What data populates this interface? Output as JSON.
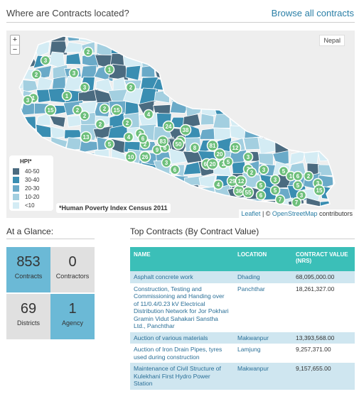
{
  "header": {
    "title": "Where are Contracts located?",
    "browse_link": "Browse all contracts"
  },
  "map": {
    "zoom_in": "+",
    "zoom_out": "−",
    "country_label": "Nepal",
    "legend": {
      "title": "HPI*",
      "items": [
        {
          "label": "40-50",
          "color": "#4b6b80"
        },
        {
          "label": "30-40",
          "color": "#3a8eb2"
        },
        {
          "label": "20-30",
          "color": "#6aaac8"
        },
        {
          "label": "10-20",
          "color": "#a3cfe0"
        },
        {
          "label": "<10",
          "color": "#d4ecf4"
        }
      ]
    },
    "footnote": "*Human Poverty Index Census 2011",
    "attribution": {
      "leaflet": "Leaflet",
      "sep": " | © ",
      "osm": "OpenStreetMap",
      "suffix": " contributors"
    },
    "markers": [
      "2",
      "3",
      "1",
      "2",
      "3",
      "1",
      "3",
      "1",
      "2",
      "3",
      "15",
      "2",
      "2",
      "2",
      "4",
      "2",
      "2",
      "15",
      "4",
      "2",
      "2",
      "13",
      "5",
      "6",
      "9",
      "24",
      "38",
      "6",
      "6",
      "83",
      "50",
      "8",
      "81",
      "12",
      "3",
      "2",
      "20",
      "5",
      "10",
      "26",
      "3",
      "6",
      "63",
      "20",
      "3",
      "3",
      "5",
      "1",
      "6",
      "3",
      "2",
      "3",
      "15",
      "5",
      "3",
      "5",
      "29",
      "5",
      "36",
      "55",
      "6",
      "7",
      "7",
      "4",
      "12",
      "2"
    ]
  },
  "glance": {
    "title": "At a Glance:",
    "tiles": [
      {
        "value": "853",
        "label": "Contracts",
        "bg": "#6bb9d6"
      },
      {
        "value": "0",
        "label": "Contractors",
        "bg": "#e0e0e0"
      },
      {
        "value": "69",
        "label": "Districts",
        "bg": "#e0e0e0"
      },
      {
        "value": "1",
        "label": "Agency",
        "bg": "#6bb9d6"
      }
    ]
  },
  "top_contracts": {
    "title": "Top Contracts (By Contract Value)",
    "columns": [
      "NAME",
      "LOCATION",
      "CONTRACT VALUE (NRs)"
    ],
    "rows": [
      {
        "name": "Asphalt concrete work",
        "location": "Dhading",
        "value": "68,095,000.00"
      },
      {
        "name": "Construction, Testing and Commissioning and Handing over of 11/0.4/0.23 kV Electrical Distribution Network for Jor Pokhari Gramin Vidut Sahakari Sanstha Ltd., Panchthar",
        "location": "Panchthar",
        "value": "18,261,327.00"
      },
      {
        "name": "Auction of various materials",
        "location": "Makwanpur",
        "value": "13,393,568.00"
      },
      {
        "name": "Auction of Iron Drain Pipes, tyres used during construction",
        "location": "Lamjung",
        "value": "9,257,371.00"
      },
      {
        "name": "Maintenance of Civil Structure of Kulekhani First Hydro Power Station",
        "location": "Makwanpur",
        "value": "9,157,655.00"
      }
    ]
  }
}
